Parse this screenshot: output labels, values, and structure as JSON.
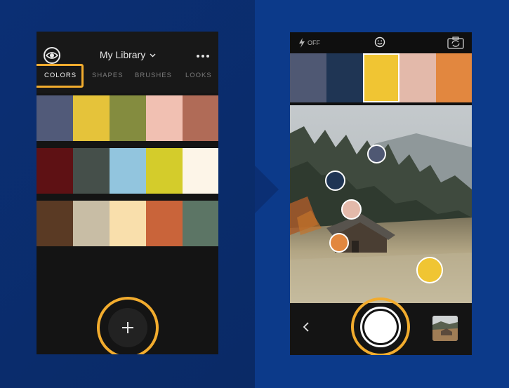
{
  "colors": {
    "accent": "#f2ac2e"
  },
  "library": {
    "title": "My Library",
    "tabs": [
      {
        "label": "COLORS",
        "active": true
      },
      {
        "label": "SHAPES",
        "active": false
      },
      {
        "label": "BRUSHES",
        "active": false
      },
      {
        "label": "LOOKS",
        "active": false
      }
    ],
    "swatch_rows": [
      [
        "#515a79",
        "#e5c33a",
        "#848c3f",
        "#f1c0b2",
        "#b06b57"
      ],
      [
        "#5e1114",
        "#454f4a",
        "#92c5de",
        "#d4cc2b",
        "#fdf5e8"
      ],
      [
        "#5a3a24",
        "#c8bda5",
        "#f9dfac",
        "#c9643a",
        "#5c7565"
      ]
    ],
    "add_button_label": "+"
  },
  "capture": {
    "flash_label": "OFF",
    "palette": [
      "#4f5873",
      "#1f3554",
      "#f0c533",
      "#e3b9aa",
      "#e2873f"
    ],
    "selected_index": 2,
    "samples": [
      "#4f5873",
      "#1f3554",
      "#e3b9aa",
      "#e2873f",
      "#f0c533"
    ],
    "icons": [
      "flash-icon",
      "smile-icon",
      "camera-swap-icon",
      "back-icon",
      "shutter-button",
      "gallery-thumbnail"
    ]
  }
}
